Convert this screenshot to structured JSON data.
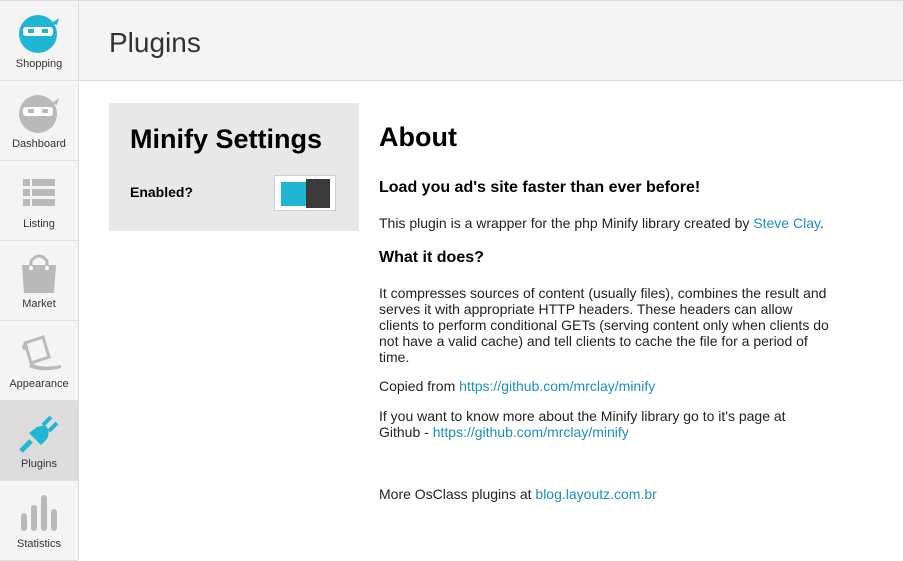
{
  "page_title": "Plugins",
  "sidebar": {
    "items": [
      {
        "label": "Shopping",
        "icon": "ninja-face-icon"
      },
      {
        "label": "Dashboard",
        "icon": "ninja-face-icon"
      },
      {
        "label": "Listing",
        "icon": "list-icon"
      },
      {
        "label": "Market",
        "icon": "shopping-bag-icon"
      },
      {
        "label": "Appearance",
        "icon": "paint-bucket-icon"
      },
      {
        "label": "Plugins",
        "icon": "plug-icon"
      },
      {
        "label": "Statistics",
        "icon": "bar-chart-icon"
      }
    ],
    "active_color": "#1fb6d5"
  },
  "settings": {
    "title": "Minify Settings",
    "enabled_label": "Enabled?",
    "enabled": true
  },
  "about": {
    "title": "About",
    "tagline": "Load you ad's site faster than ever before!",
    "intro_text": "This plugin is a wrapper for the php Minify library created by ",
    "author_link": "Steve Clay",
    "what_title": "What it does?",
    "what_text": "It compresses sources of content (usually files), combines the result and serves it with appropriate HTTP headers. These headers can allow clients to perform conditional GETs (serving content only when clients do not have a valid cache) and tell clients to cache the file for a period of time.",
    "copied_text": "Copied from ",
    "copied_link": "https://github.com/mrclay/minify",
    "more_text": "If you want to know more about the Minify library go to it's page at Github - ",
    "more_link": "https://github.com/mrclay/minify",
    "plugins_text": "More OsClass plugins at ",
    "plugins_link": "blog.layoutz.com.br"
  }
}
